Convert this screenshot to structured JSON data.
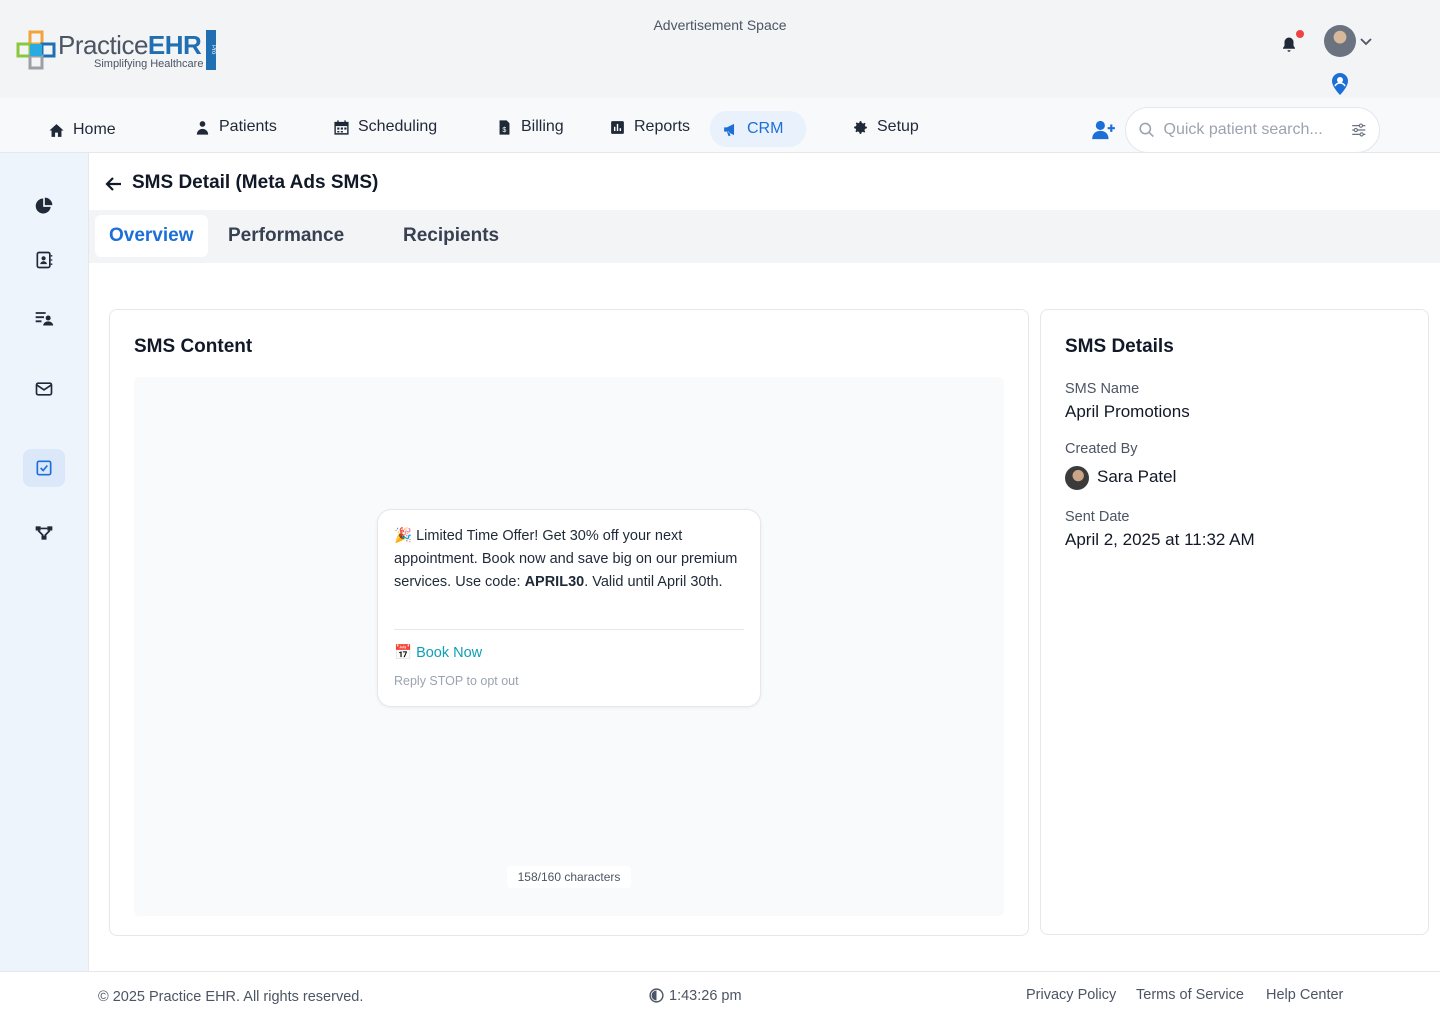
{
  "header": {
    "logo_name_light": "Practice",
    "logo_name_bold": "EHR",
    "logo_tagline": "Simplifying Healthcare",
    "logo_badge": "Pro",
    "ad_space": "Advertisement Space"
  },
  "nav": {
    "items": [
      {
        "label": "Home",
        "icon": "home-icon"
      },
      {
        "label": "Patients",
        "icon": "user-doctor-icon"
      },
      {
        "label": "Scheduling",
        "icon": "calendar-icon"
      },
      {
        "label": "Billing",
        "icon": "invoice-icon"
      },
      {
        "label": "Reports",
        "icon": "chart-icon"
      },
      {
        "label": "CRM",
        "icon": "megaphone-icon",
        "active": true
      },
      {
        "label": "Setup",
        "icon": "gear-icon"
      }
    ],
    "search_placeholder": "Quick patient search..."
  },
  "sidebar": {
    "icons": [
      "pie-chart-icon",
      "contacts-icon",
      "user-list-icon",
      "mail-icon",
      "checkbox-icon",
      "workflow-icon"
    ],
    "active_index": 4
  },
  "page": {
    "title": "SMS Detail (Meta Ads SMS)",
    "tabs": [
      {
        "label": "Overview",
        "active": true
      },
      {
        "label": "Performance"
      },
      {
        "label": "Recipients"
      }
    ]
  },
  "sms_content": {
    "title": "SMS Content",
    "message_emoji": "🎉",
    "message_before_code": "Limited Time Offer! Get 30% off your next appointment. Book now and save big on our premium services. Use code:",
    "promo_code": "APRIL30",
    "message_after_code": ". Valid until April 30th.",
    "cta_emoji": "📅",
    "cta_label": "Book Now",
    "opt_out": "Reply STOP to opt out",
    "char_count": "158/160 characters"
  },
  "sms_details": {
    "title": "SMS Details",
    "name_label": "SMS Name",
    "name_value": "April Promotions",
    "created_by_label": "Created By",
    "created_by_value": "Sara Patel",
    "sent_date_label": "Sent Date",
    "sent_date_value": "April 2, 2025 at 11:32 AM"
  },
  "footer": {
    "copyright": "© 2025 Practice EHR. All rights reserved.",
    "time": "1:43:26 pm",
    "links": [
      "Privacy Policy",
      "Terms of Service",
      "Help Center"
    ]
  },
  "colors": {
    "primary": "#1d6fd8",
    "link_teal": "#0f9fb5",
    "notification": "#ef4444",
    "sidebar_bg": "#eef4fc"
  }
}
